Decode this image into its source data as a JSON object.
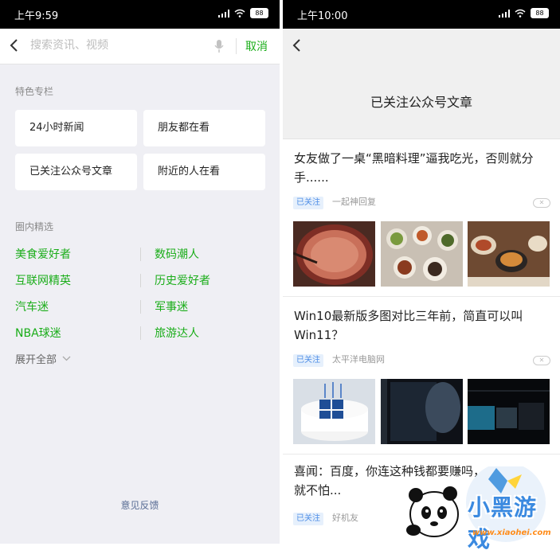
{
  "left": {
    "status_time": "上午9:59",
    "battery": "88",
    "search_placeholder": "搜索资讯、视频",
    "cancel_label": "取消",
    "featured_title": "特色专栏",
    "featured": [
      "24小时新闻",
      "朋友都在看",
      "已关注公众号文章",
      "附近的人在看"
    ],
    "circle_title": "圈内精选",
    "circle": [
      [
        "美食爱好者",
        "数码潮人"
      ],
      [
        "互联网精英",
        "历史爱好者"
      ],
      [
        "汽车迷",
        "军事迷"
      ],
      [
        "NBA球迷",
        "旅游达人"
      ]
    ],
    "expand_label": "展开全部",
    "feedback_label": "意见反馈"
  },
  "right": {
    "status_time": "上午10:00",
    "battery": "88",
    "header_title": "已关注公众号文章",
    "articles": [
      {
        "title": "女友做了一桌“黑暗料理”逼我吃光，否则就分手......",
        "tag": "已关注",
        "source": "一起神回复"
      },
      {
        "title": "Win10最新版多图对比三年前，简直可以叫Win11？",
        "tag": "已关注",
        "source": "太平洋电脑网"
      },
      {
        "title": "喜闻：百度，你连这种钱都要赚吗，就不怕...",
        "tag": "已关注",
        "source": "好机友"
      }
    ]
  },
  "watermark": {
    "text": "小黑游戏",
    "url": "www.xiaohei.com"
  },
  "colors": {
    "accent": "#1aad19",
    "link": "#586c94",
    "tag_blue": "#4f8ee6"
  }
}
